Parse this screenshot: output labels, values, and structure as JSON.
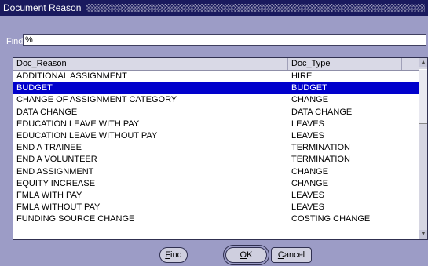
{
  "window": {
    "title": "Document Reason"
  },
  "find": {
    "label": "Find",
    "value": "%"
  },
  "list": {
    "columns": [
      "Doc_Reason",
      "Doc_Type"
    ],
    "selected_index": 1,
    "rows": [
      {
        "reason": "ADDITIONAL ASSIGNMENT",
        "type": "HIRE"
      },
      {
        "reason": "BUDGET",
        "type": "BUDGET"
      },
      {
        "reason": "CHANGE OF ASSIGNMENT CATEGORY",
        "type": "CHANGE"
      },
      {
        "reason": "DATA CHANGE",
        "type": "DATA CHANGE"
      },
      {
        "reason": "EDUCATION LEAVE WITH PAY",
        "type": "LEAVES"
      },
      {
        "reason": "EDUCATION LEAVE WITHOUT PAY",
        "type": "LEAVES"
      },
      {
        "reason": "END A TRAINEE",
        "type": "TERMINATION"
      },
      {
        "reason": "END A VOLUNTEER",
        "type": "TERMINATION"
      },
      {
        "reason": "END ASSIGNMENT",
        "type": "CHANGE"
      },
      {
        "reason": "EQUITY INCREASE",
        "type": "CHANGE"
      },
      {
        "reason": "FMLA WITH PAY",
        "type": "LEAVES"
      },
      {
        "reason": "FMLA WITHOUT PAY",
        "type": "LEAVES"
      },
      {
        "reason": "FUNDING SOURCE CHANGE",
        "type": "COSTING CHANGE"
      }
    ]
  },
  "buttons": {
    "find": {
      "mnemonic": "F",
      "rest": "ind"
    },
    "ok": {
      "mnemonic": "O",
      "rest": "K"
    },
    "cancel": {
      "mnemonic": "C",
      "rest": "ancel"
    }
  },
  "icons": {
    "scroll_up": "triangle-up-icon",
    "scroll_down": "triangle-down-icon"
  }
}
